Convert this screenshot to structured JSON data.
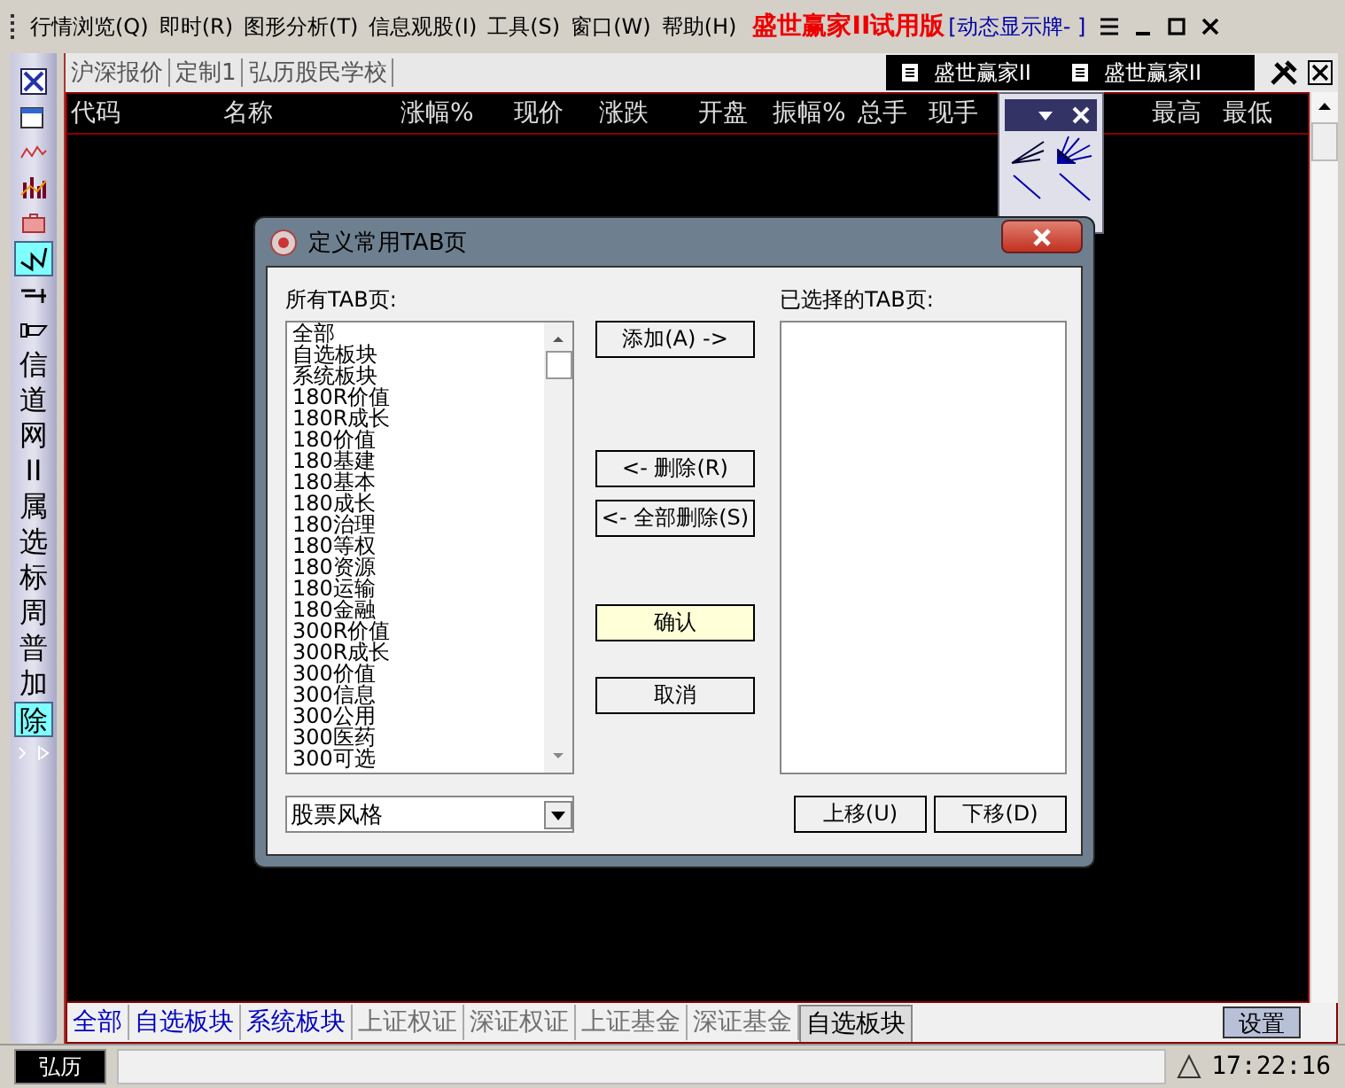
{
  "menu": [
    "行情浏览(Q)",
    "即时(R)",
    "图形分析(T)",
    "信息观股(I)",
    "工具(S)",
    "窗口(W)",
    "帮助(H)"
  ],
  "app_title": "盛世赢家II试用版",
  "ticker": "[动态显示牌-  ]",
  "top_tabs": [
    "沪深报价",
    "定制1",
    "弘历股民学校"
  ],
  "windows": [
    "盛世赢家II",
    "盛世赢家II"
  ],
  "columns": [
    "代码",
    "名称",
    "涨幅%",
    "现价",
    "涨跌",
    "开盘",
    "振幅%",
    "总手",
    "现手",
    "最高",
    "最低"
  ],
  "toolbar": [
    {
      "kind": "icon",
      "selected": false
    },
    {
      "kind": "icon",
      "selected": false
    },
    {
      "kind": "icon",
      "selected": false
    },
    {
      "kind": "icon",
      "selected": false
    },
    {
      "kind": "icon",
      "selected": false
    },
    {
      "kind": "icon",
      "selected": true
    },
    {
      "kind": "icon",
      "selected": false
    },
    {
      "kind": "icon",
      "selected": false
    },
    {
      "kind": "text",
      "label": "信",
      "selected": false
    },
    {
      "kind": "text",
      "label": "道",
      "selected": false
    },
    {
      "kind": "text",
      "label": "网",
      "selected": false
    },
    {
      "kind": "text",
      "label": "II",
      "selected": false
    },
    {
      "kind": "text",
      "label": "属",
      "selected": false
    },
    {
      "kind": "text",
      "label": "选",
      "selected": false
    },
    {
      "kind": "text",
      "label": "标",
      "selected": false
    },
    {
      "kind": "text",
      "label": "周",
      "selected": false
    },
    {
      "kind": "text",
      "label": "普",
      "selected": false
    },
    {
      "kind": "text",
      "label": "加",
      "selected": false
    },
    {
      "kind": "text",
      "label": "除",
      "selected": true
    }
  ],
  "dialog": {
    "title": "定义常用TAB页",
    "all_label": "所有TAB页:",
    "selected_label": "已选择的TAB页:",
    "all_items": [
      "全部",
      "自选板块",
      "系统板块",
      "180R价值",
      "180R成长",
      "180价值",
      "180基建",
      "180基本",
      "180成长",
      "180治理",
      "180等权",
      "180资源",
      "180运输",
      "180金融",
      "300R价值",
      "300R成长",
      "300价值",
      "300信息",
      "300公用",
      "300医药",
      "300可选"
    ],
    "category": "股票风格",
    "buttons": [
      {
        "label": "添加(A) ->",
        "default": false
      },
      {
        "label": "<- 删除(R)",
        "default": false
      },
      {
        "label": "<- 全部删除(S)",
        "default": false
      },
      {
        "label": "确认",
        "default": true
      },
      {
        "label": "取消",
        "default": false
      }
    ],
    "move_buttons": [
      "上移(U)",
      "下移(D)"
    ]
  },
  "bottom_tabs": [
    {
      "label": "全部",
      "color": "#0000c0",
      "selected": false
    },
    {
      "label": "自选板块",
      "color": "#0000c0",
      "selected": false
    },
    {
      "label": "系统板块",
      "color": "#0000c0",
      "selected": false
    },
    {
      "label": "上证权证",
      "color": "#707070",
      "selected": false
    },
    {
      "label": "深证权证",
      "color": "#707070",
      "selected": false
    },
    {
      "label": "上证基金",
      "color": "#707070",
      "selected": false
    },
    {
      "label": "深证基金",
      "color": "#707070",
      "selected": false
    },
    {
      "label": "自选板块",
      "color": "#000000",
      "selected": true
    }
  ],
  "settings_button": "设置",
  "status": {
    "user": "弘历",
    "time": "17:22:16"
  }
}
